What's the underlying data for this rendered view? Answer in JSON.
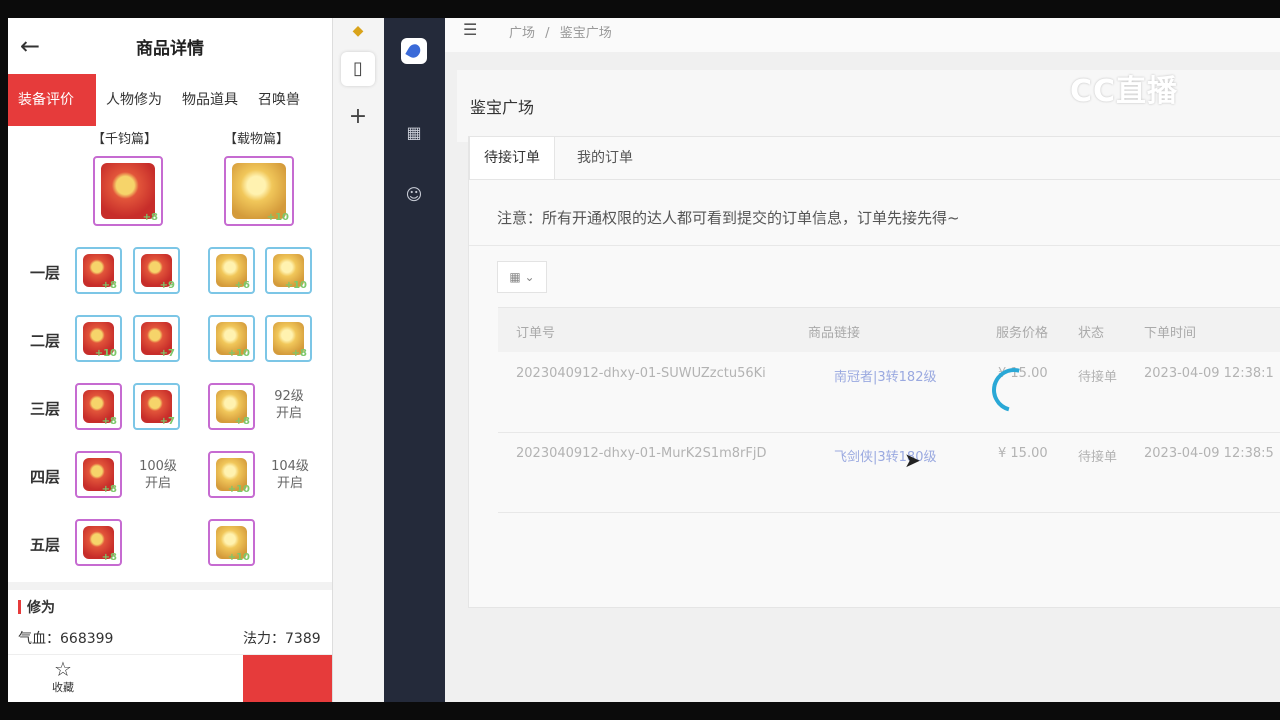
{
  "mobile": {
    "title": "商品详情",
    "tabs": [
      "装备评价",
      "人物修为",
      "物品道具",
      "召唤兽"
    ],
    "col1_header": "【千钧篇】",
    "col2_header": "【载物篇】",
    "rows": [
      "一层",
      "二层",
      "三层",
      "四层",
      "五层"
    ],
    "top_items": {
      "left_num": "+8",
      "right_num": "+10"
    },
    "grid_nums": {
      "r1": [
        "+8",
        "+9",
        "+6",
        "+10"
      ],
      "r2": [
        "+10",
        "+7",
        "+10",
        "+8"
      ],
      "r3": [
        "+8",
        "+7",
        "+8"
      ],
      "r4": [
        "+8",
        "+10"
      ],
      "r5": [
        "+8",
        "+10"
      ]
    },
    "locked": {
      "r3c4": "92级\n开启",
      "r4c2": "100级\n开启",
      "r4c4": "104级\n开启"
    },
    "section_title": "修为",
    "stat_hp": "气血：668399",
    "stat_mp": "法力：7389",
    "fav_label": "收藏",
    "colors": {
      "accent": "#e63b3b"
    }
  },
  "main": {
    "breadcrumb_1": "广场",
    "breadcrumb_sep": "/",
    "breadcrumb_2": "鉴宝广场",
    "page_title": "鉴宝广场",
    "watermark": "CC直播",
    "tabs": [
      "待接订单",
      "我的订单"
    ],
    "notice": "注意：所有开通权限的达人都可看到提交的订单信息，订单先接先得~",
    "table": {
      "headers": [
        "订单号",
        "商品链接",
        "服务价格",
        "状态",
        "下单时间"
      ],
      "rows": [
        {
          "order_no": "2023040912-dhxy-01-SUWUZzctu56Ki",
          "link": "南冠者|3转182级",
          "price": "¥ 15.00",
          "status": "待接单",
          "time": "2023-04-09 12:38:1"
        },
        {
          "order_no": "2023040912-dhxy-01-MurK2S1m8rFjD",
          "link": "飞剑侠|3转180级",
          "price": "¥ 15.00",
          "status": "待接单",
          "time": "2023-04-09 12:38:5"
        }
      ]
    }
  }
}
